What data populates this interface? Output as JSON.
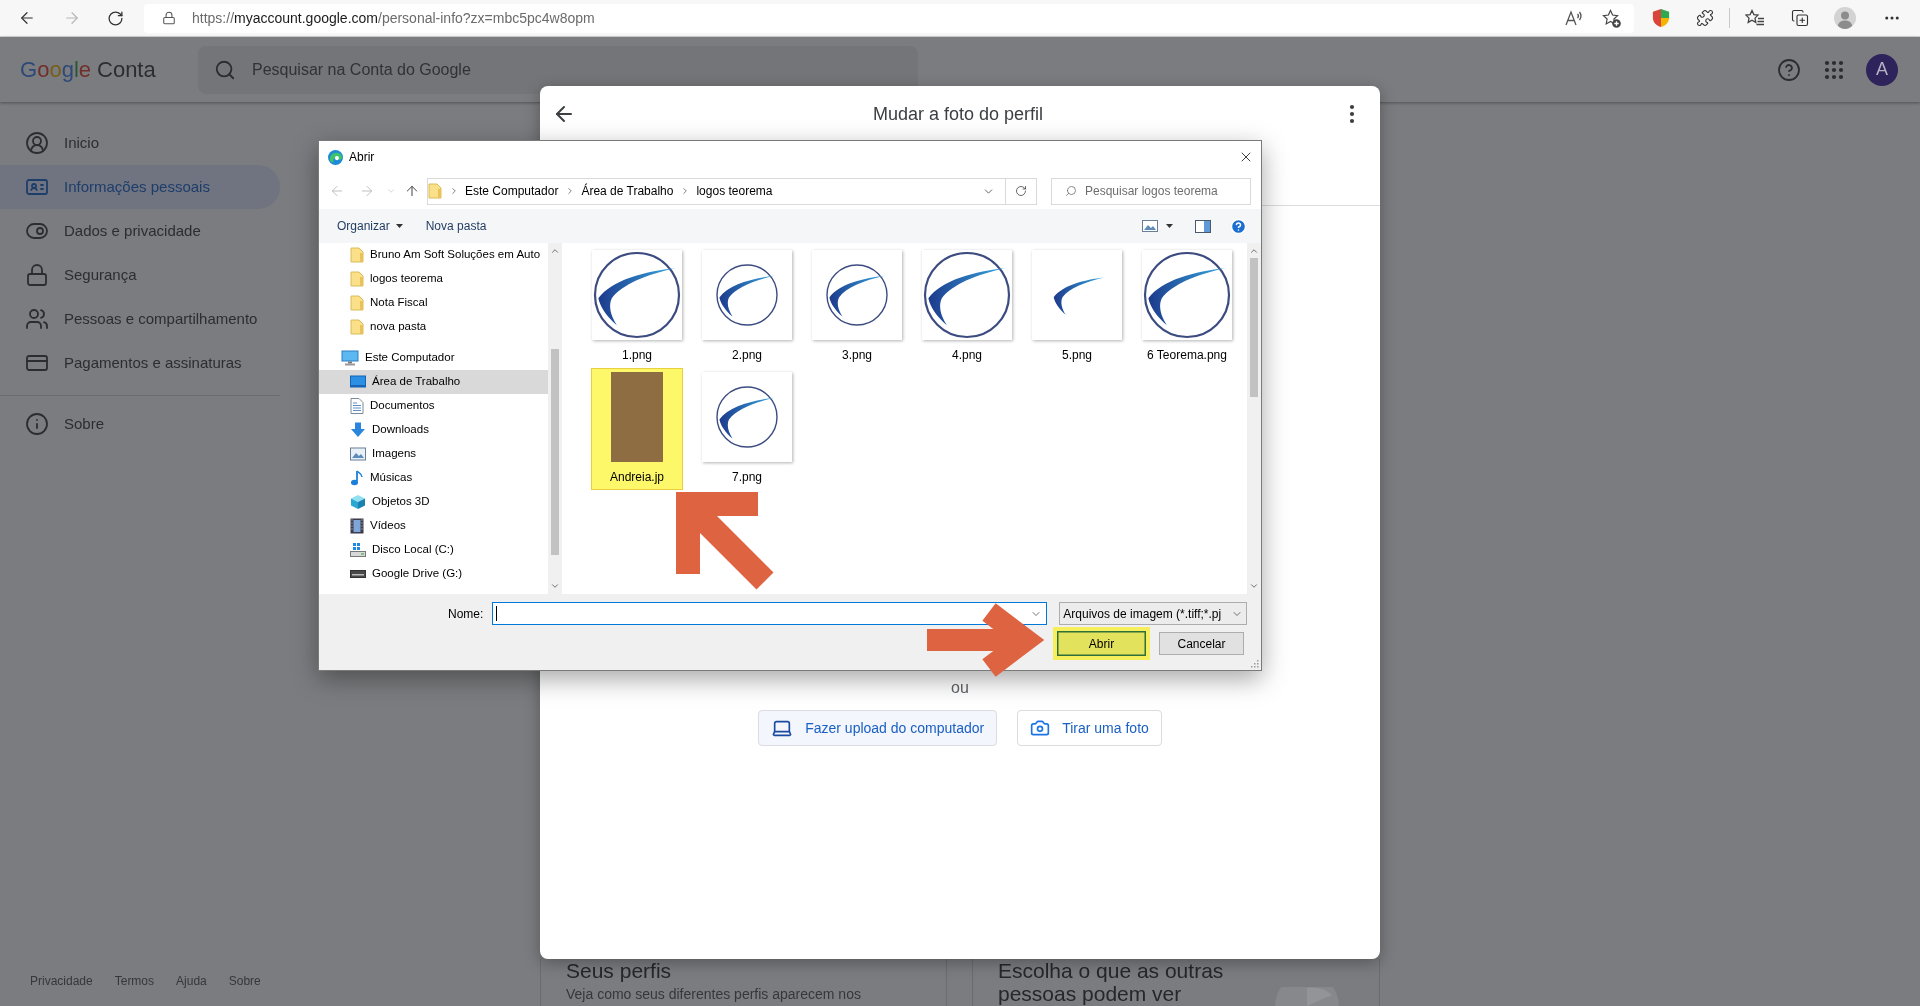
{
  "browser": {
    "url": {
      "scheme": "https://",
      "host": "myaccount.google.com",
      "path": "/personal-info?zx=mbc5pc4w8opm"
    }
  },
  "header": {
    "logo": {
      "brand": "Google",
      "product": "Conta"
    },
    "search": {
      "placeholder": "Pesquisar na Conta do Google"
    },
    "avatar": "A"
  },
  "sidebar": {
    "items": [
      {
        "label": "Inicio",
        "kind": "home",
        "selected": false
      },
      {
        "label": "Informações pessoais",
        "kind": "profile",
        "selected": true
      },
      {
        "label": "Dados e privacidade",
        "kind": "privacy",
        "selected": false
      },
      {
        "label": "Segurança",
        "kind": "security",
        "selected": false
      },
      {
        "label": "Pessoas e compartilhamento",
        "kind": "people",
        "selected": false
      },
      {
        "label": "Pagamentos e assinaturas",
        "kind": "payments",
        "selected": false
      }
    ],
    "secondary_items": [
      {
        "label": "Sobre",
        "kind": "about",
        "selected": false
      }
    ],
    "footer_links": [
      "Privacidade",
      "Termos",
      "Ajuda",
      "Sobre"
    ]
  },
  "cards": [
    {
      "title": "Seus perfis",
      "description": "Veja como seus diferentes perfis aparecem nos"
    },
    {
      "title": "Escolha o que as outras pessoas podem ver",
      "illustration": true
    }
  ],
  "modal": {
    "title": "Mudar a foto do perfil",
    "separator": "ou",
    "buttons": [
      {
        "label": "Fazer upload do computador",
        "kind": "upload",
        "focused": true
      },
      {
        "label": "Tirar uma foto",
        "kind": "camera",
        "focused": false
      }
    ]
  },
  "file_dialog": {
    "title": "Abrir",
    "path": [
      "Este Computador",
      "Área de Trabalho",
      "logos teorema"
    ],
    "search": {
      "placeholder": "Pesquisar logos teorema"
    },
    "toolbar": [
      {
        "label": "Organizar",
        "kind": "menu"
      },
      {
        "label": "Nova pasta",
        "kind": "action"
      }
    ],
    "nav_tree": [
      {
        "children": [
          {
            "label": "Bruno Am Soft Soluções em Auto",
            "kind": "folder",
            "selected": false
          },
          {
            "label": "logos teorema",
            "kind": "folder",
            "selected": false
          },
          {
            "label": "Nota Fiscal",
            "kind": "folder",
            "selected": false
          },
          {
            "label": "nova pasta",
            "kind": "folder",
            "selected": false
          }
        ]
      },
      {
        "label": "Este Computador",
        "kind": "computer",
        "selected": false,
        "children": [
          {
            "label": "Área de Trabalho",
            "kind": "desktop",
            "selected": true
          },
          {
            "label": "Documentos",
            "kind": "documents",
            "selected": false
          },
          {
            "label": "Downloads",
            "kind": "downloads",
            "selected": false
          },
          {
            "label": "Imagens",
            "kind": "pictures",
            "selected": false
          },
          {
            "label": "Músicas",
            "kind": "music",
            "selected": false
          },
          {
            "label": "Objetos 3D",
            "kind": "objects",
            "selected": false
          },
          {
            "label": "Vídeos",
            "kind": "videos",
            "selected": false
          },
          {
            "label": "Disco Local (C:)",
            "kind": "disk",
            "selected": false
          },
          {
            "label": "Google Drive (G:)",
            "kind": "drive",
            "selected": false
          }
        ]
      }
    ],
    "files": [
      {
        "name": "1.png",
        "kind": "large",
        "selected": false
      },
      {
        "name": "2.png",
        "kind": "small",
        "selected": false
      },
      {
        "name": "3.png",
        "kind": "small",
        "selected": false
      },
      {
        "name": "4.png",
        "kind": "large",
        "selected": false
      },
      {
        "name": "5.png",
        "kind": "swoosh",
        "selected": false
      },
      {
        "name": "6 Teorema.png",
        "kind": "large",
        "selected": false
      },
      {
        "name": "Andreia.jp",
        "kind": "photo",
        "selected": true
      },
      {
        "name": "7.png",
        "kind": "small",
        "selected": false
      }
    ],
    "name_field": {
      "label": "Nome:",
      "focused": true
    },
    "file_type": "Arquivos de imagem (*.tiff;*.pj",
    "buttons": [
      {
        "label": "Abrir",
        "highlighted": true
      },
      {
        "label": "Cancelar",
        "highlighted": false
      }
    ]
  }
}
